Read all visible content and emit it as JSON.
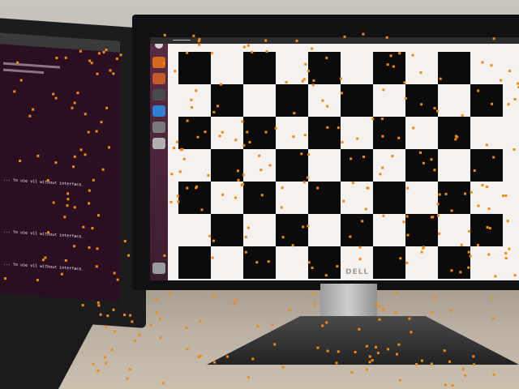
{
  "scene": {
    "description_visible_text": "DELL",
    "brand_logo": "DELL",
    "marker_color": "#f08a12",
    "board": {
      "rows": 7,
      "cols": 10
    },
    "terminal_lines": [
      "... to use v1l without interface.",
      "... to use v1l without interface.",
      "... to use v1l without interface."
    ]
  }
}
